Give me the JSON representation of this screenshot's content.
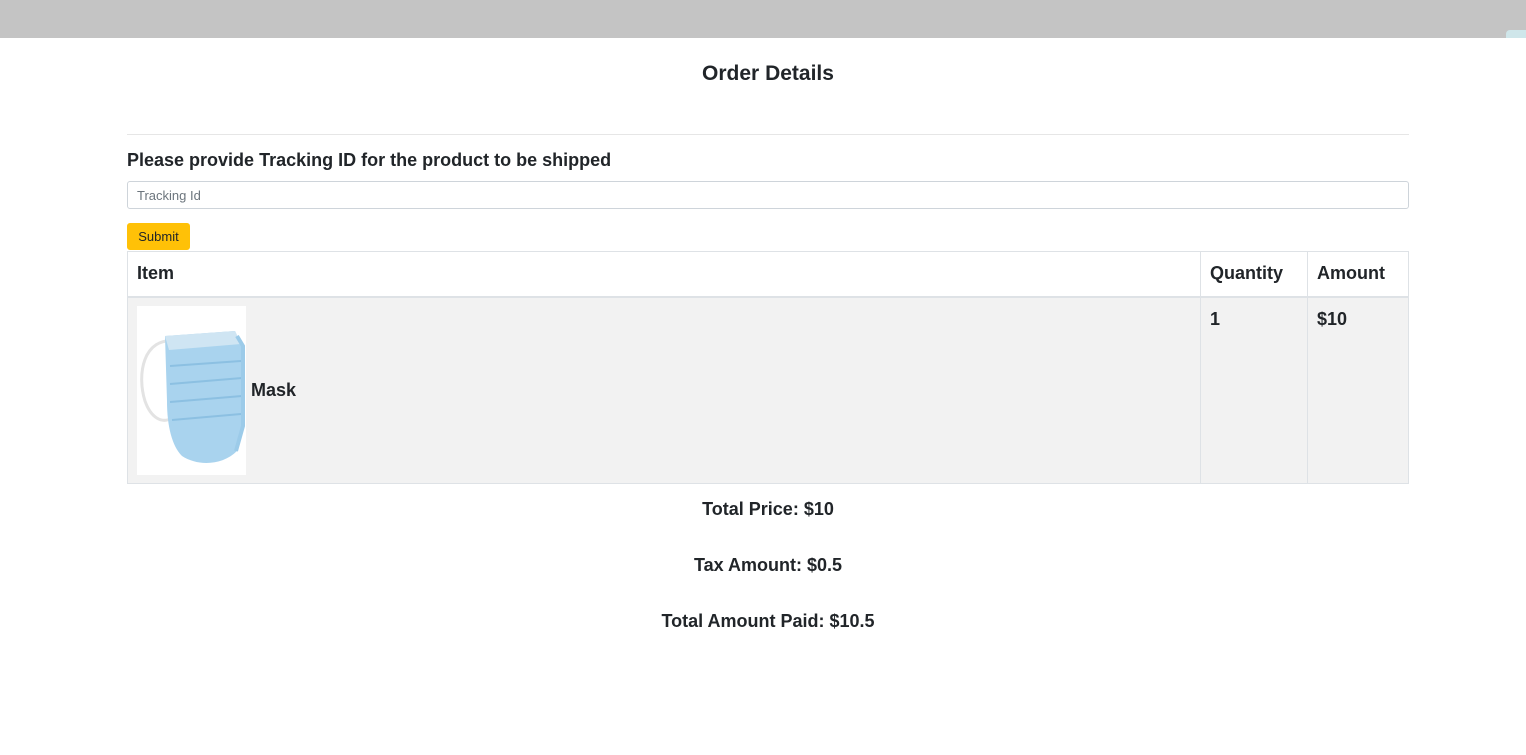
{
  "modal": {
    "title": "Order Details",
    "tracking_prompt": "Please provide Tracking ID for the product to be shipped",
    "tracking_input": {
      "value": "",
      "placeholder": "Tracking Id"
    },
    "submit_label": "Submit"
  },
  "table": {
    "headers": {
      "item": "Item",
      "quantity": "Quantity",
      "amount": "Amount"
    },
    "rows": [
      {
        "icon": "face-mask-image",
        "name": "Mask",
        "quantity": "1",
        "amount": "$10"
      }
    ]
  },
  "summary": {
    "total_price": "Total Price: $10",
    "tax_amount": "Tax Amount: $0.5",
    "total_paid": "Total Amount Paid: $10.5"
  },
  "colors": {
    "overlay": "#c4c4c4",
    "submit_button": "#ffc107",
    "row_background": "#f2f2f2",
    "mask_blue": "#a9d3ee"
  }
}
